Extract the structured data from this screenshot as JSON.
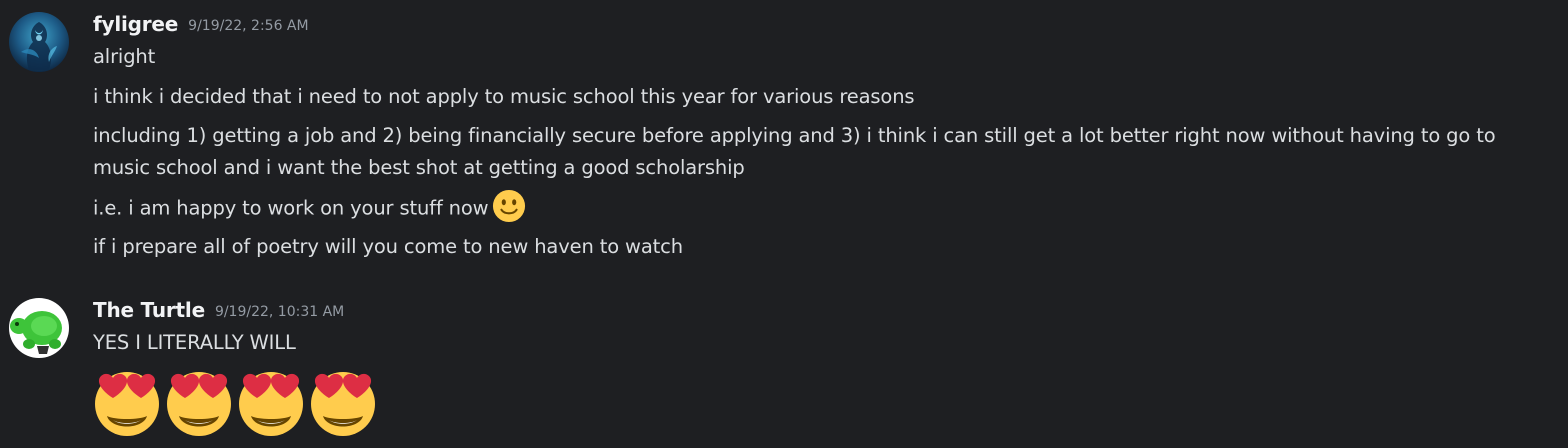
{
  "messages": [
    {
      "author": "fyligree",
      "timestamp": "9/19/22, 2:56 AM",
      "avatar_icon": "fyligree-avatar",
      "lines": [
        "alright",
        "i think i decided that i need to not apply to music school this year for various reasons",
        "including 1) getting a job and 2) being financially secure before applying and 3) i think i can still get a lot better right now without having to go to music school and i want the best shot at getting a good scholarship",
        "i.e. i am happy to work on your stuff now",
        "if i prepare all of poetry will you come to new haven to watch"
      ],
      "emoji": "slightly-smiling-face"
    },
    {
      "author": "The Turtle",
      "timestamp": "9/19/22, 10:31 AM",
      "avatar_icon": "turtle-avatar",
      "lines": [
        "YES I LITERALLY WILL"
      ],
      "emoji_row": [
        "heart-eyes",
        "heart-eyes",
        "heart-eyes",
        "heart-eyes"
      ]
    }
  ],
  "colors": {
    "background": "#1e1f22",
    "text": "#dbdee1",
    "username": "#f2f3f5",
    "timestamp": "#949ba4",
    "emoji_yellow": "#ffcc4d",
    "heart_red": "#dd2e44"
  }
}
